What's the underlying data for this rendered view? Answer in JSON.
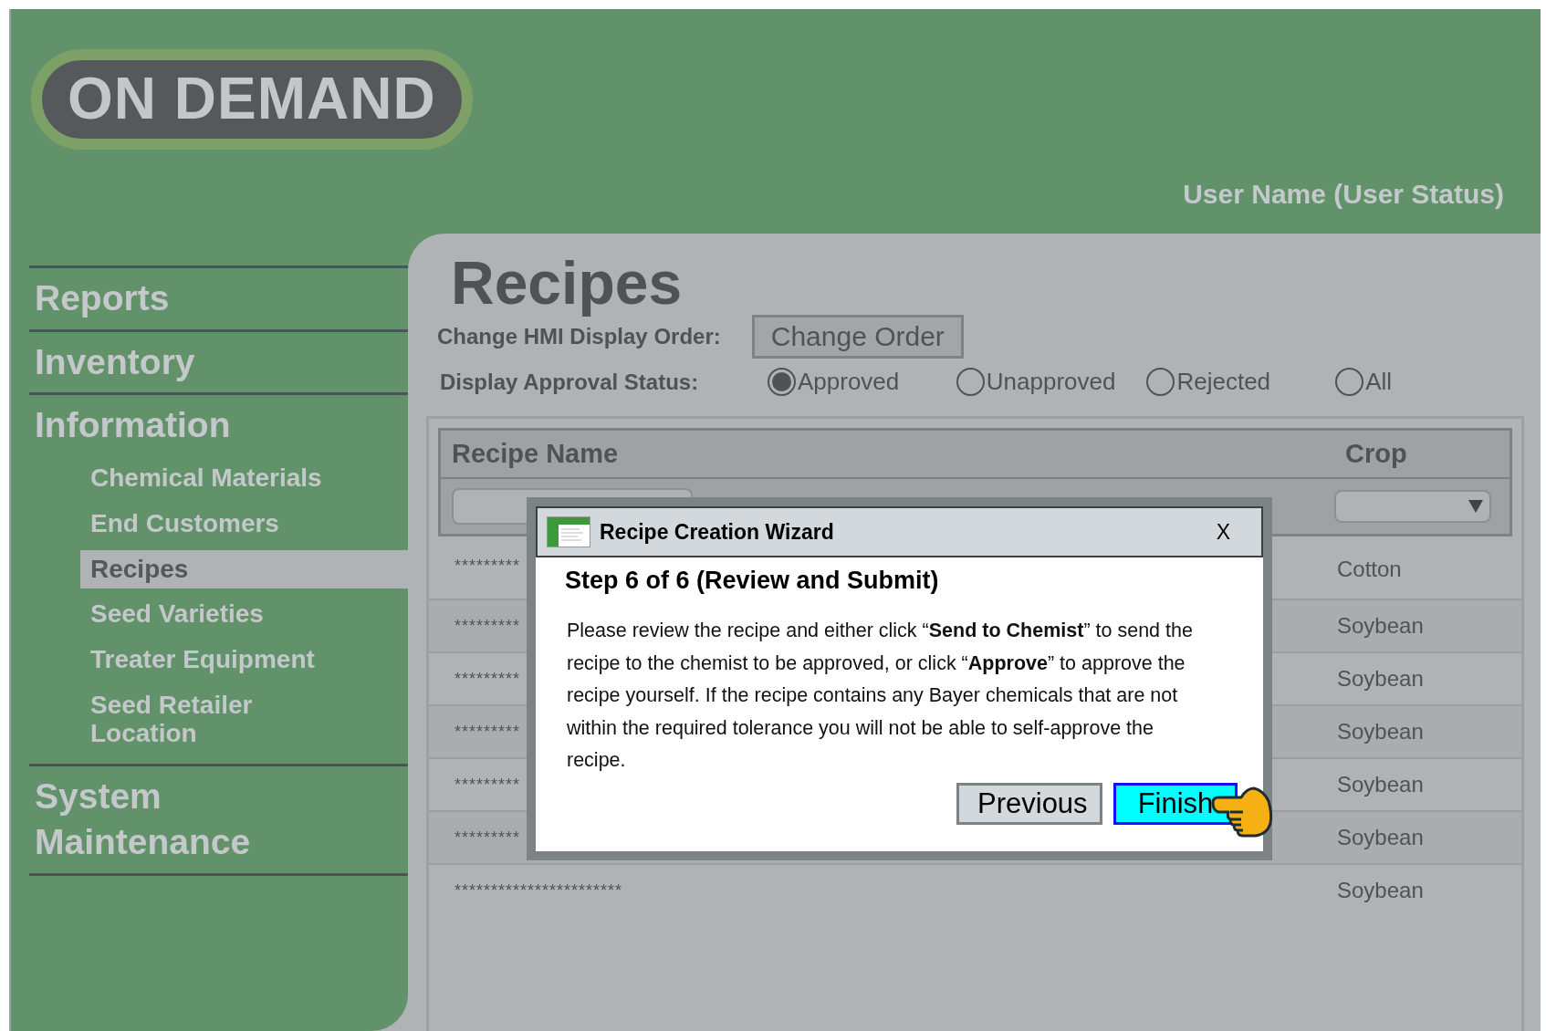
{
  "header": {
    "logo": "ON DEMAND",
    "user": "User Name (User Status)"
  },
  "sidebar": {
    "items": [
      {
        "label": "Reports",
        "selected": false
      },
      {
        "label": "Inventory",
        "selected": false
      },
      {
        "label": "Information",
        "selected": false,
        "children": [
          {
            "label": "Chemical Materials",
            "selected": false
          },
          {
            "label": "End Customers",
            "selected": false
          },
          {
            "label": "Recipes",
            "selected": true
          },
          {
            "label": "Seed Varieties",
            "selected": false
          },
          {
            "label": "Treater Equipment",
            "selected": false
          },
          {
            "label": "Seed Retailer Location",
            "selected": false
          }
        ]
      },
      {
        "label": "System Maintenance",
        "selected": false
      }
    ]
  },
  "page": {
    "title": "Recipes",
    "order_label": "Change HMI Display Order:",
    "order_button": "Change Order",
    "status_label": "Display Approval Status:",
    "status_options": [
      {
        "label": "Approved",
        "selected": true
      },
      {
        "label": "Unapproved",
        "selected": false
      },
      {
        "label": "Rejected",
        "selected": false
      },
      {
        "label": "All",
        "selected": false
      }
    ]
  },
  "table": {
    "columns": [
      "Recipe Name",
      "Crop"
    ],
    "rows": [
      {
        "recipe_name": "*********",
        "crop": "Cotton"
      },
      {
        "recipe_name": "*********",
        "crop": "Soybean"
      },
      {
        "recipe_name": "*********",
        "crop": "Soybean"
      },
      {
        "recipe_name": "*********",
        "crop": "Soybean"
      },
      {
        "recipe_name": "*********",
        "crop": "Soybean"
      },
      {
        "recipe_name": "*********",
        "crop": "Soybean"
      },
      {
        "recipe_name": "***********************",
        "crop": "Soybean"
      }
    ]
  },
  "dialog": {
    "title": "Recipe Creation Wizard",
    "close": "X",
    "step": "Step 6 of 6 (Review and Submit)",
    "message": "Please review the recipe and either click “**Send to Chemist**” to send the recipe to the chemist to be approved, or click “**Approve**” to approve the recipe yourself. If the recipe contains any Bayer chemicals that are not within the required tolerance you will not be able to self-approve the recipe.",
    "buttons": [
      {
        "label": "Previous",
        "kind": "secondary"
      },
      {
        "label": "Finish",
        "kind": "primary"
      }
    ]
  }
}
